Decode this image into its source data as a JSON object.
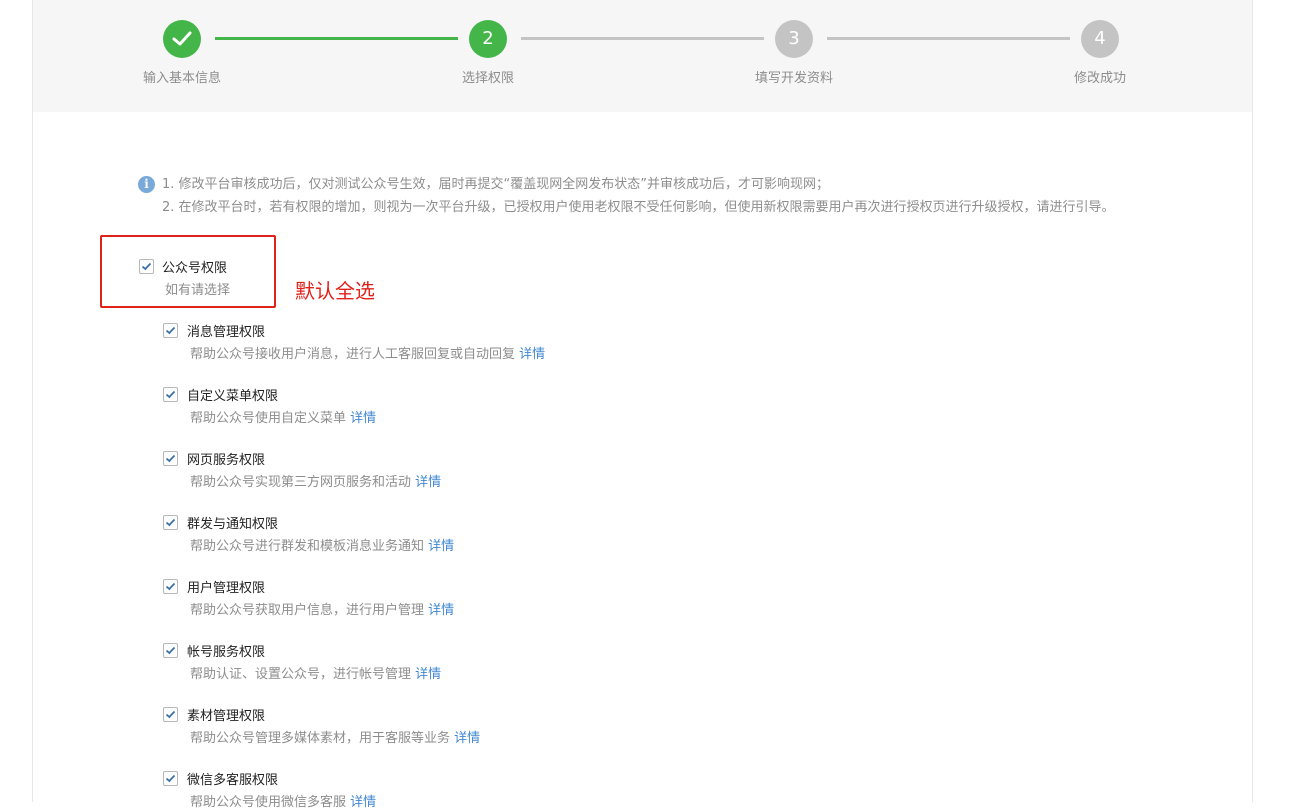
{
  "steps": [
    {
      "number": "",
      "label": "输入基本信息",
      "state": "done"
    },
    {
      "number": "2",
      "label": "选择权限",
      "state": "active"
    },
    {
      "number": "3",
      "label": "填写开发资料",
      "state": "todo"
    },
    {
      "number": "4",
      "label": "修改成功",
      "state": "todo"
    }
  ],
  "notice": {
    "line1": "1. 修改平台审核成功后，仅对测试公众号生效，届时再提交“覆盖现网全网发布状态”并审核成功后，才可影响现网；",
    "line2": "2. 在修改平台时，若有权限的增加，则视为一次平台升级，已授权用户使用老权限不受任何影响，但使用新权限需要用户再次进行授权页进行升级授权，请进行引导。"
  },
  "group": {
    "title": "公众号权限",
    "subtitle": "如有请选择",
    "checked": true
  },
  "annotation": "默认全选",
  "permissions": [
    {
      "title": "消息管理权限",
      "desc": "帮助公众号接收用户消息，进行人工客服回复或自动回复",
      "link": "详情",
      "checked": true
    },
    {
      "title": "自定义菜单权限",
      "desc": "帮助公众号使用自定义菜单",
      "link": "详情",
      "checked": true
    },
    {
      "title": "网页服务权限",
      "desc": "帮助公众号实现第三方网页服务和活动",
      "link": "详情",
      "checked": true
    },
    {
      "title": "群发与通知权限",
      "desc": "帮助公众号进行群发和模板消息业务通知",
      "link": "详情",
      "checked": true
    },
    {
      "title": "用户管理权限",
      "desc": "帮助公众号获取用户信息，进行用户管理",
      "link": "详情",
      "checked": true
    },
    {
      "title": "帐号服务权限",
      "desc": "帮助认证、设置公众号，进行帐号管理",
      "link": "详情",
      "checked": true
    },
    {
      "title": "素材管理权限",
      "desc": "帮助公众号管理多媒体素材，用于客服等业务",
      "link": "详情",
      "checked": true
    },
    {
      "title": "微信多客服权限",
      "desc": "帮助公众号使用微信多客服",
      "link": "详情",
      "checked": true
    }
  ],
  "colors": {
    "accent": "#44b549",
    "pending": "#c4c4c4",
    "annotation": "#e0221b",
    "link": "#4188d0"
  }
}
